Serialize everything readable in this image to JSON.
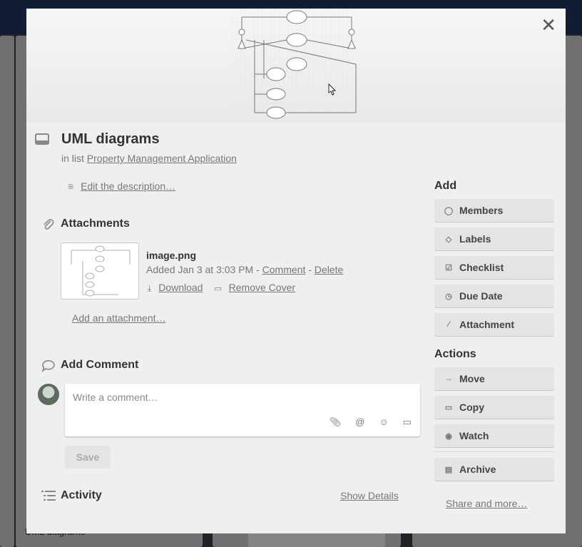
{
  "background": {
    "card_uml": "UML diagrams"
  },
  "card": {
    "title": "UML diagrams",
    "in_list_prefix": "in list",
    "list_name": "Property Management Application",
    "edit_description": "Edit the description…"
  },
  "attachments": {
    "title": "Attachments",
    "file_name": "image.png",
    "added_text": "Added Jan 3 at 3:03 PM - ",
    "comment_link": "Comment",
    "dash": " - ",
    "delete_link": "Delete",
    "download": "Download",
    "remove_cover": "Remove Cover",
    "add_attachment": "Add an attachment…"
  },
  "comment": {
    "title": "Add Comment",
    "placeholder": "Write a comment…",
    "save": "Save"
  },
  "activity": {
    "title": "Activity",
    "show_details": "Show Details"
  },
  "sidebar": {
    "add_title": "Add",
    "add_buttons": [
      {
        "label": "Members",
        "icon": "person-icon"
      },
      {
        "label": "Labels",
        "icon": "tag-icon"
      },
      {
        "label": "Checklist",
        "icon": "checkbox-icon"
      },
      {
        "label": "Due Date",
        "icon": "clock-icon"
      },
      {
        "label": "Attachment",
        "icon": "paperclip-icon"
      }
    ],
    "actions_title": "Actions",
    "action_buttons": [
      {
        "label": "Move",
        "icon": "arrow-right-icon"
      },
      {
        "label": "Copy",
        "icon": "card-icon"
      },
      {
        "label": "Watch",
        "icon": "eye-icon"
      },
      {
        "label": "Archive",
        "icon": "archive-icon"
      }
    ],
    "share": "Share and more…"
  },
  "colors": {
    "header_bar": "#1e3560",
    "modal_bg": "#edeff0",
    "button_bg": "#e2e4e6"
  }
}
